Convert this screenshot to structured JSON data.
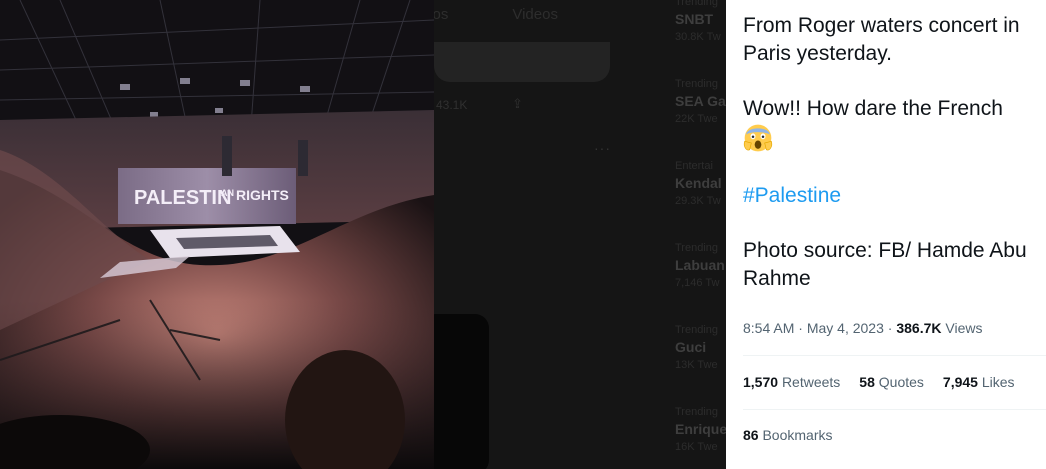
{
  "background": {
    "tabs": [
      "otos",
      "Videos"
    ],
    "stats": {
      "views_fragment": "43.1K"
    },
    "trends": [
      {
        "category": "Trending",
        "name": "SNBT",
        "count": "30.8K Tw"
      },
      {
        "category": "Trending",
        "name": "SEA Ga",
        "count": "22K Twe"
      },
      {
        "category": "Entertai",
        "name": "Kendal",
        "count": "29.3K Tw"
      },
      {
        "category": "Trending",
        "name": "Labuan",
        "count": "7,146 Tw"
      },
      {
        "category": "Trending",
        "name": "Guci",
        "count": "13K Twe"
      },
      {
        "category": "Trending",
        "name": "Enrique",
        "count": "16K Twe"
      }
    ]
  },
  "photo": {
    "screen_text": "PALESTIN",
    "screen_text_small": "AN",
    "screen_text_end": "RIGHTS"
  },
  "tweet": {
    "line1": "From Roger waters concert in Paris yesterday.",
    "line2": "Wow!! How dare the French",
    "emoji": "face-screaming-in-fear",
    "hashtag": "#Palestine",
    "line4": "Photo source: FB/ Hamde Abu Rahme",
    "time": "8:54 AM",
    "separator": "·",
    "date": "May 4, 2023",
    "views_count": "386.7K",
    "views_label": "Views",
    "retweets_count": "1,570",
    "retweets_label": "Retweets",
    "quotes_count": "58",
    "quotes_label": "Quotes",
    "likes_count": "7,945",
    "likes_label": "Likes",
    "bookmarks_count": "86",
    "bookmarks_label": "Bookmarks"
  },
  "colors": {
    "link": "#1d9bf0",
    "text_primary": "#0f1419",
    "text_secondary": "#536471",
    "divider": "#eff3f4"
  }
}
